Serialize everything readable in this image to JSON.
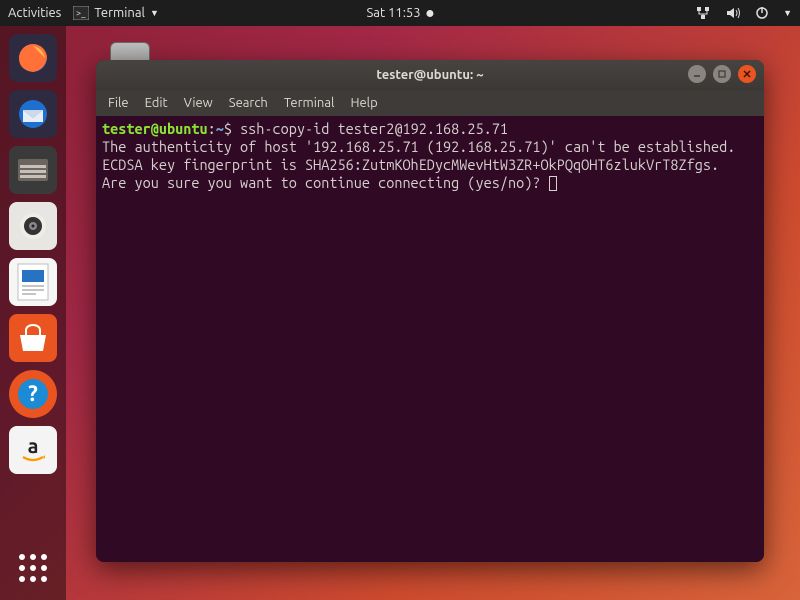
{
  "topbar": {
    "activities": "Activities",
    "app_label": "Terminal",
    "clock": "Sat 11:53"
  },
  "desktop": {
    "trash_label": ""
  },
  "window": {
    "title": "tester@ubuntu: ~",
    "menubar": [
      "File",
      "Edit",
      "View",
      "Search",
      "Terminal",
      "Help"
    ]
  },
  "terminal": {
    "prompt_user": "tester@ubuntu",
    "prompt_sep": ":",
    "prompt_path": "~",
    "prompt_suffix": "$ ",
    "command": "ssh-copy-id tester2@192.168.25.71",
    "line1": "The authenticity of host '192.168.25.71 (192.168.25.71)' can't be established.",
    "line2": "ECDSA key fingerprint is SHA256:ZutmKOhEDycMWevHtW3ZR+OkPQqOHT6zlukVrT8Zfgs.",
    "line3": "Are you sure you want to continue connecting (yes/no)? "
  }
}
